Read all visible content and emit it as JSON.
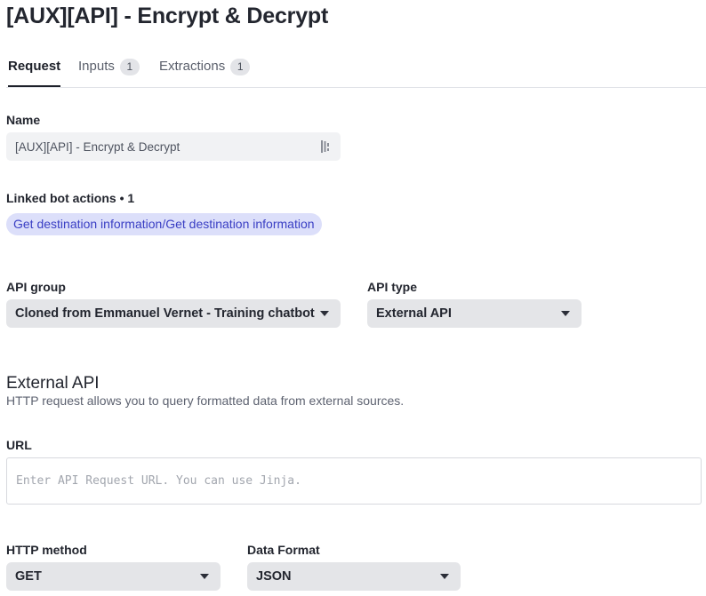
{
  "page": {
    "title": "[AUX][API] - Encrypt & Decrypt"
  },
  "tabs": [
    {
      "label": "Request",
      "active": true
    },
    {
      "label": "Inputs",
      "count": "1"
    },
    {
      "label": "Extractions",
      "count": "1"
    }
  ],
  "name": {
    "label": "Name",
    "value": "[AUX][API] - Encrypt & Decrypt"
  },
  "linked": {
    "label": "Linked bot actions • 1",
    "chip": "Get destination information/Get destination information"
  },
  "api_group": {
    "label": "API group",
    "value": "Cloned from Emmanuel Vernet - Training chatbot"
  },
  "api_type": {
    "label": "API type",
    "value": "External API"
  },
  "external": {
    "title": "External API",
    "description": "HTTP request allows you to query formatted data from external sources."
  },
  "url": {
    "label": "URL",
    "value": "",
    "placeholder": "Enter API Request URL. You can use Jinja."
  },
  "http_method": {
    "label": "HTTP method",
    "value": "GET"
  },
  "data_format": {
    "label": "Data Format",
    "value": "JSON"
  },
  "colors": {
    "chip_bg": "#dcdffa",
    "chip_text": "#3a3fc4",
    "select_bg": "#e4e5e8",
    "active_tab": "#1d2029"
  },
  "icons": {
    "name_field_icon": "grip-icon",
    "select_icon": "caret-down-icon"
  }
}
